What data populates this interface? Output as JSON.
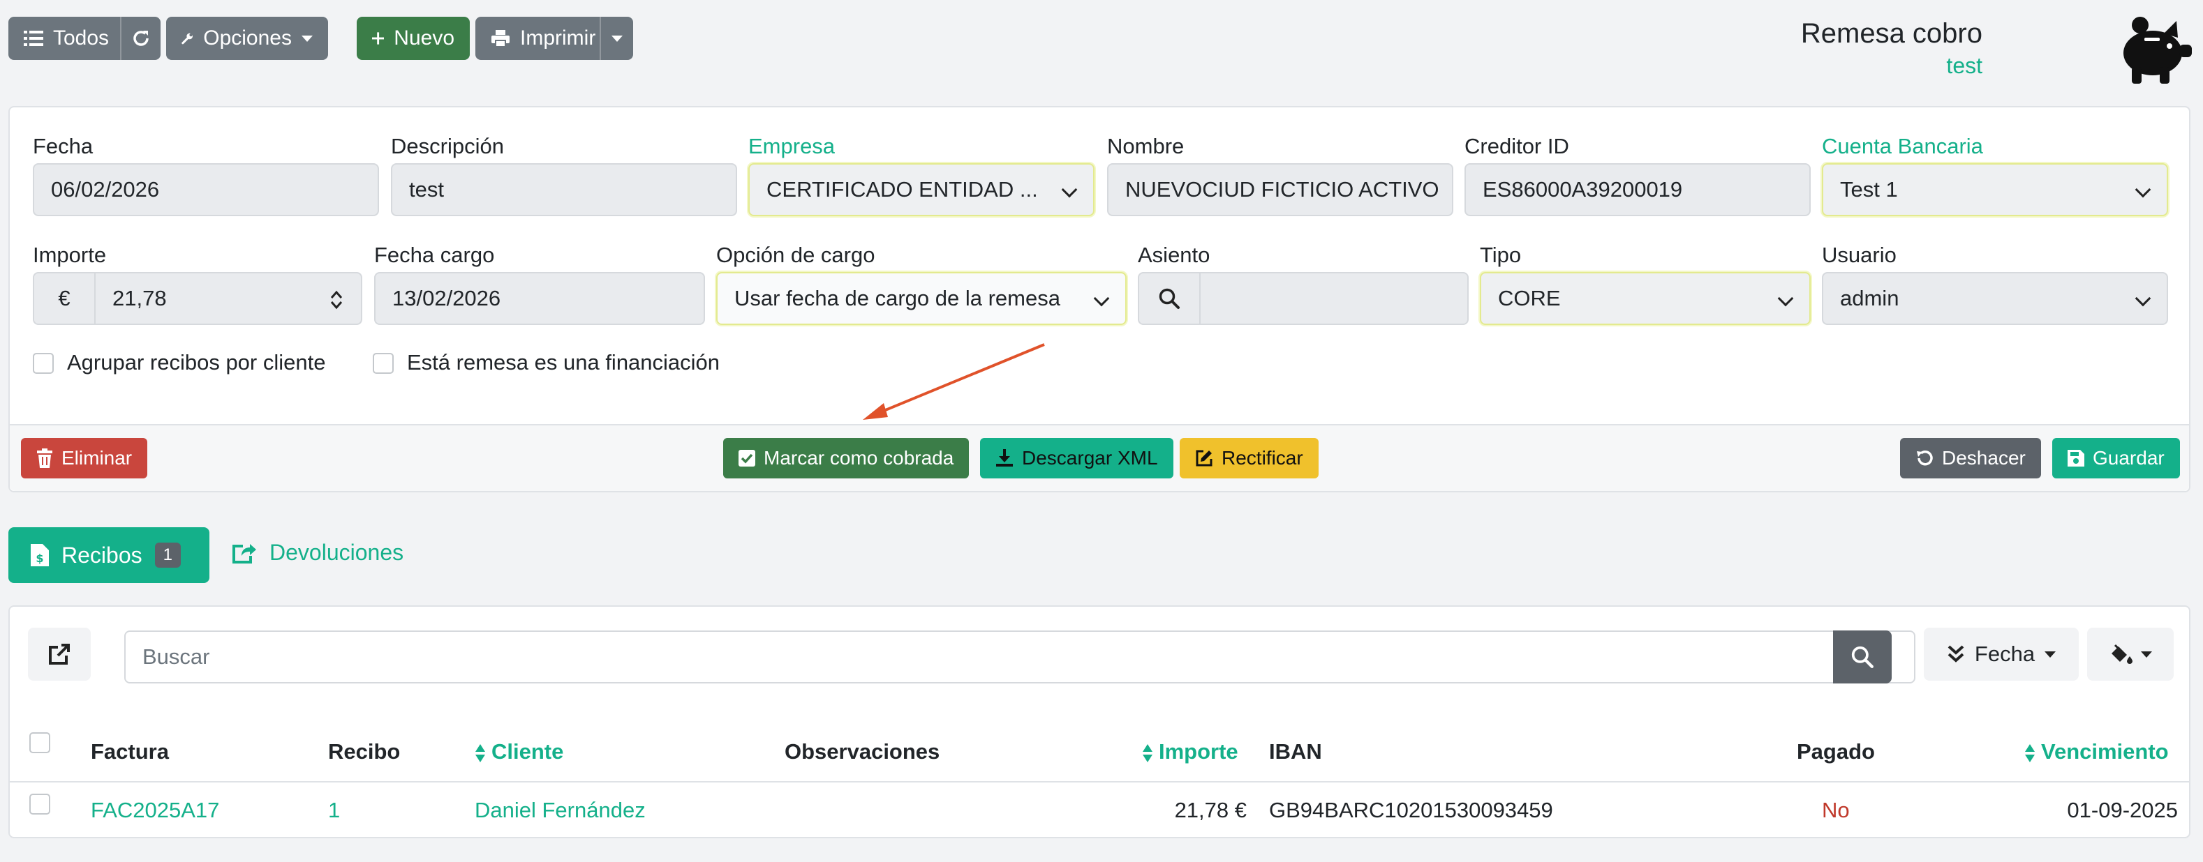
{
  "toolbar": {
    "todos_label": "Todos",
    "opciones_label": "Opciones",
    "nuevo_label": "Nuevo",
    "imprimir_label": "Imprimir"
  },
  "header": {
    "title": "Remesa cobro",
    "subtitle": "test"
  },
  "form": {
    "fecha": {
      "label": "Fecha",
      "value": "06/02/2026"
    },
    "descripcion": {
      "label": "Descripción",
      "value": "test"
    },
    "empresa": {
      "label": "Empresa",
      "value": "CERTIFICADO ENTIDAD ..."
    },
    "nombre": {
      "label": "Nombre",
      "value": "NUEVOCIUD FICTICIO ACTIVO"
    },
    "creditor": {
      "label": "Creditor ID",
      "value": "ES86000A39200019"
    },
    "cuenta": {
      "label": "Cuenta Bancaria",
      "value": "Test 1"
    },
    "importe": {
      "label": "Importe",
      "currency": "€",
      "value": "21,78"
    },
    "fecha_cargo": {
      "label": "Fecha cargo",
      "value": "13/02/2026"
    },
    "opcion_cargo": {
      "label": "Opción de cargo",
      "value": "Usar fecha de cargo de la remesa"
    },
    "asiento": {
      "label": "Asiento",
      "value": ""
    },
    "tipo": {
      "label": "Tipo",
      "value": "CORE"
    },
    "usuario": {
      "label": "Usuario",
      "value": "admin"
    },
    "agrupar_label": "Agrupar recibos por cliente",
    "financiacion_label": "Está remesa es una financiación"
  },
  "actions": {
    "eliminar": "Eliminar",
    "marcar": "Marcar como cobrada",
    "descargar": "Descargar XML",
    "rectificar": "Rectificar",
    "deshacer": "Deshacer",
    "guardar": "Guardar"
  },
  "tabs": {
    "recibos_label": "Recibos",
    "recibos_count": "1",
    "devoluciones_label": "Devoluciones"
  },
  "list": {
    "search_placeholder": "Buscar",
    "order_label": "Fecha",
    "columns": {
      "factura": "Factura",
      "recibo": "Recibo",
      "cliente": "Cliente",
      "observaciones": "Observaciones",
      "importe": "Importe",
      "iban": "IBAN",
      "pagado": "Pagado",
      "vencimiento": "Vencimiento"
    },
    "rows": [
      {
        "factura": "FAC2025A17",
        "recibo": "1",
        "cliente": "Daniel Fernández",
        "observaciones": "",
        "importe": "21,78 €",
        "iban": "GB94BARC10201530093459",
        "pagado": "No",
        "vencimiento": "01-09-2025"
      }
    ]
  },
  "colors": {
    "teal": "#14b08a",
    "gray": "#6c757d",
    "green_dark": "#3b7d48",
    "danger": "#c9463d",
    "warning": "#f0c12c",
    "arrow": "#e0522a"
  }
}
